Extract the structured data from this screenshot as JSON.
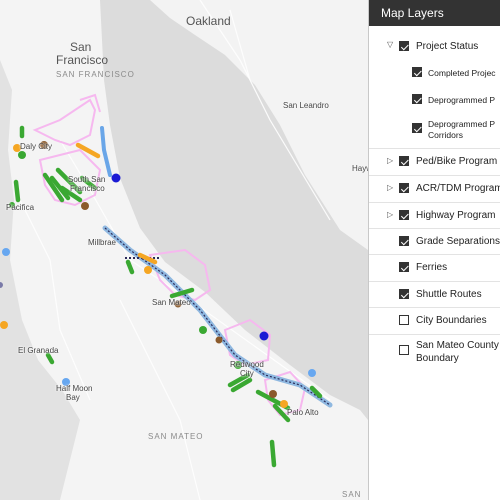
{
  "map": {
    "labels": {
      "oakland": "Oakland",
      "san": "San",
      "francisco": "Francisco",
      "san_francisco_district": "SAN FRANCISCO",
      "san_leandro": "San Leandro",
      "hayward_partial": "Hayw",
      "daly_city": "Daly City",
      "south_san": "South San",
      "south_francisco": "Francisco",
      "pacifica": "Pacifica",
      "millbrae": "Millbrae",
      "san_mateo": "San Mateo",
      "el_granada": "El Granada",
      "half_moon": "Half Moon",
      "bay": "Bay",
      "redwood": "Redwood",
      "city": "City",
      "palo_alto": "Palo Alto",
      "san_mateo_district": "SAN MATEO",
      "santa_clara_partial": "SAN"
    },
    "colors": {
      "water": "#dcdcdc",
      "land": "#f4f4f4",
      "ped_bike": "#3aa832",
      "completed": "#f5a623",
      "deprogrammed": "#8b5a2b",
      "city_boundary": "#f6b8ef",
      "ferry": "#67a7f0",
      "highway": "#6aa6e8",
      "shuttle_dark": "#1b1bd4"
    }
  },
  "layers_panel": {
    "title": "Map Layers",
    "items": [
      {
        "label": "Project Status",
        "checked": true,
        "expander": "down",
        "level": 0
      },
      {
        "label": "Completed Projec",
        "checked": true,
        "level": 1
      },
      {
        "label": "Deprogrammed P",
        "checked": true,
        "level": 1
      },
      {
        "label": "Deprogrammed P",
        "label2": "Corridors",
        "checked": true,
        "level": 1
      },
      {
        "label": "Ped/Bike Program",
        "checked": true,
        "expander": "right",
        "level": 0
      },
      {
        "label": "ACR/TDM Program",
        "checked": true,
        "expander": "right",
        "level": 0
      },
      {
        "label": "Highway Program",
        "checked": true,
        "expander": "right",
        "level": 0
      },
      {
        "label": "Grade Separations",
        "checked": true,
        "level": 0
      },
      {
        "label": "Ferries",
        "checked": true,
        "level": 0
      },
      {
        "label": "Shuttle Routes",
        "checked": true,
        "level": 0
      },
      {
        "label": "City Boundaries",
        "checked": false,
        "level": 0
      },
      {
        "label": "San Mateo County",
        "label2": "Boundary",
        "checked": false,
        "level": 0
      }
    ]
  }
}
